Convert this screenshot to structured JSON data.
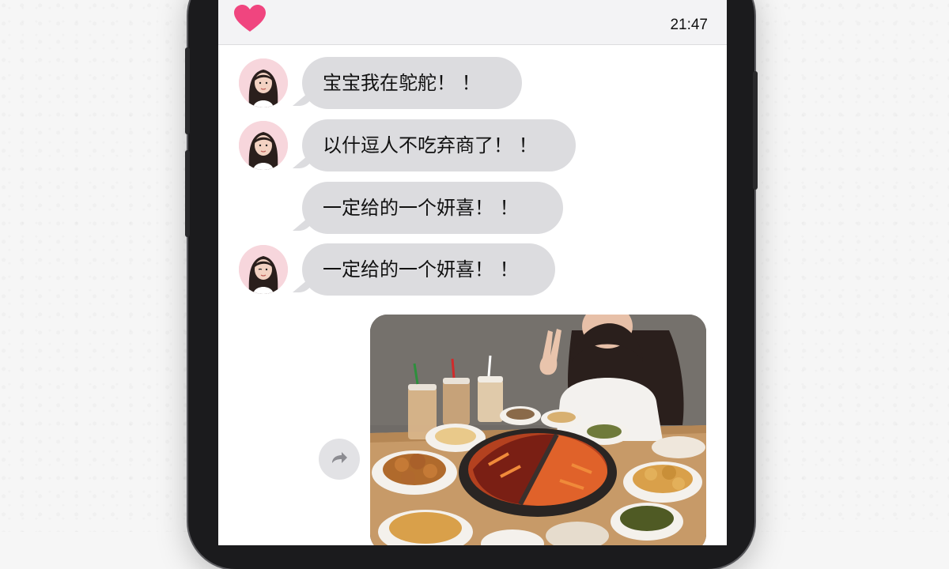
{
  "status_bar": {
    "time": "21:47",
    "icons": {
      "left": "heart-icon"
    }
  },
  "colors": {
    "heart": "#f0457f",
    "bubble": "#dcdcdf",
    "avatar_bg": "#f7d6dc",
    "phone_frame": "#1b1b1d"
  },
  "messages": [
    {
      "text": "宝宝我在鸵舵！ ！",
      "avatar": true
    },
    {
      "text": "以什逗人不吃弃商了！ ！",
      "avatar": true
    },
    {
      "text": "一定给的一个妍喜！ ！",
      "avatar": false
    },
    {
      "text": "一定给的一个妍喜！ ！",
      "avatar": true
    }
  ],
  "photo_message": {
    "description_icon": "hotpot-photo",
    "share_icon": "share-icon"
  }
}
